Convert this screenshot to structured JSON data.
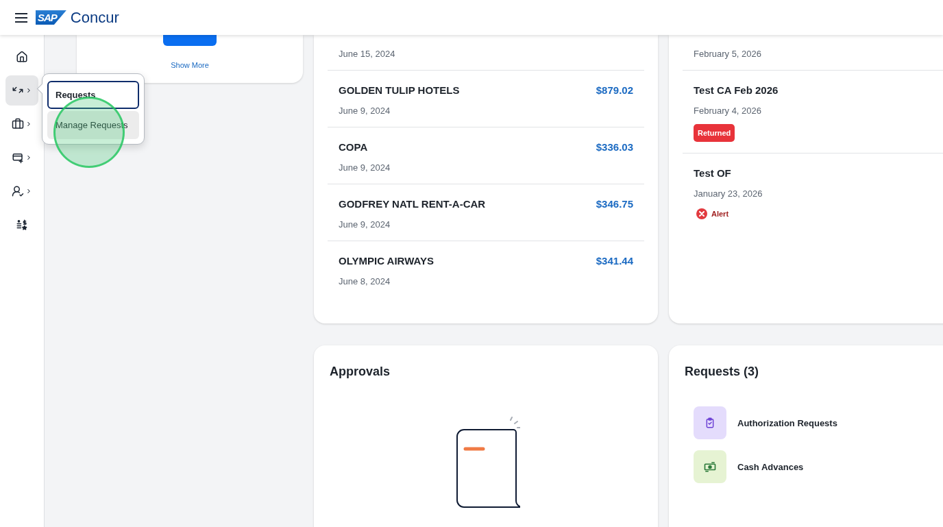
{
  "header": {
    "logo_mark": "SAP",
    "logo_text": "Concur"
  },
  "rail": [
    {
      "kind": "home",
      "submenu": false,
      "selected": false
    },
    {
      "kind": "requests",
      "submenu": true,
      "selected": true
    },
    {
      "kind": "travel",
      "submenu": true,
      "selected": false
    },
    {
      "kind": "expense",
      "submenu": true,
      "selected": false
    },
    {
      "kind": "approvals",
      "submenu": true,
      "selected": false
    },
    {
      "kind": "reports",
      "submenu": false,
      "selected": false
    }
  ],
  "flyout": {
    "items": [
      {
        "label": "Requests",
        "focused": true
      },
      {
        "label": "Manage Requests",
        "focused": false
      }
    ]
  },
  "click_marker": {
    "shown": true
  },
  "search_card": {
    "link": "Show More"
  },
  "transactions": [
    {
      "date": "June 15, 2024"
    },
    {
      "title": "GOLDEN TULIP HOTELS",
      "amount": "$879.02",
      "date": "June 9, 2024"
    },
    {
      "title": "COPA",
      "amount": "$336.03",
      "date": "June 9, 2024"
    },
    {
      "title": "GODFREY NATL RENT-A-CAR",
      "amount": "$346.75",
      "date": "June 9, 2024"
    },
    {
      "title": "OLYMPIC AIRWAYS",
      "amount": "$341.44",
      "date": "June 8, 2024"
    }
  ],
  "reports": [
    {
      "date": "February 5, 2026"
    },
    {
      "title": "Test CA Feb 2026",
      "date": "February 4, 2026",
      "status": {
        "kind": "badge",
        "label": "Returned"
      }
    },
    {
      "title": "Test OF",
      "date": "January 23, 2026",
      "status": {
        "kind": "alert",
        "label": "Alert"
      }
    }
  ],
  "approvals": {
    "title": "Approvals"
  },
  "requests": {
    "title": "Requests (3)",
    "items": [
      {
        "kind": "authorization",
        "label": "Authorization Requests",
        "color": "#e4dcfc"
      },
      {
        "kind": "cash",
        "label": "Cash Advances",
        "color": "#e6f3d3"
      }
    ]
  }
}
